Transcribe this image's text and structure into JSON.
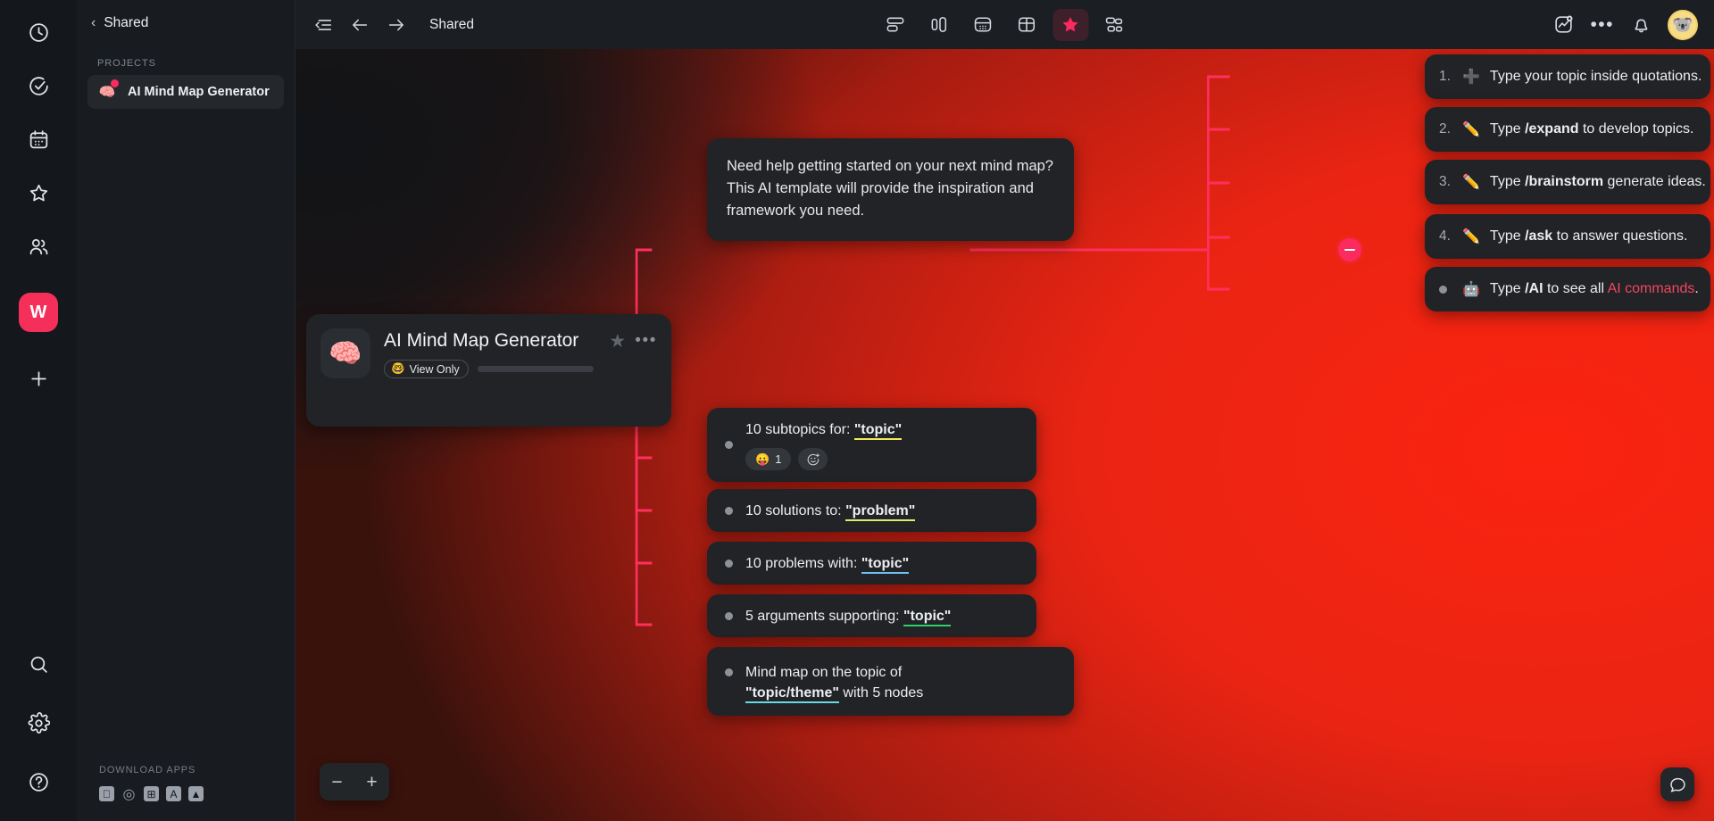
{
  "rail": {
    "items": [
      {
        "name": "recent-icon",
        "label": "Recent"
      },
      {
        "name": "tasks-icon",
        "label": "Tasks"
      },
      {
        "name": "calendar-icon",
        "label": "Calendar"
      },
      {
        "name": "favorites-icon",
        "label": "Favorites"
      },
      {
        "name": "people-icon",
        "label": "People"
      }
    ],
    "workspace_initial": "W",
    "add_label": "+",
    "bottom": [
      {
        "name": "search-icon",
        "label": "Search"
      },
      {
        "name": "settings-icon",
        "label": "Settings"
      },
      {
        "name": "help-icon",
        "label": "Help"
      }
    ],
    "accent": "#f42f5a"
  },
  "sidebar": {
    "back_chevron": "‹",
    "title": "Shared",
    "section_label": "PROJECTS",
    "project": {
      "emoji": "🧠",
      "label": "AI Mind Map Generator"
    },
    "footer": {
      "title": "DOWNLOAD APPS",
      "apps": [
        {
          "name": "apple-icon",
          "glyph": ""
        },
        {
          "name": "chrome-icon",
          "glyph": "◎"
        },
        {
          "name": "windows-icon",
          "glyph": "⊞"
        },
        {
          "name": "app-store-icon",
          "glyph": "A"
        },
        {
          "name": "android-icon",
          "glyph": "▲"
        }
      ]
    }
  },
  "topbar": {
    "breadcrumb": "Shared",
    "views": [
      {
        "name": "list-view",
        "label": "List",
        "active": false
      },
      {
        "name": "board-view",
        "label": "Board",
        "active": false
      },
      {
        "name": "calendar-view",
        "label": "Calendar",
        "active": false
      },
      {
        "name": "table-view",
        "label": "Table",
        "active": false
      },
      {
        "name": "favorite-view",
        "label": "Favorite",
        "active": true
      },
      {
        "name": "mindmap-view",
        "label": "Mind Map",
        "active": false
      }
    ],
    "more_label": "•••",
    "avatar_emoji": "🐨"
  },
  "card": {
    "emoji": "🧠",
    "title": "AI Mind Map Generator",
    "badge": {
      "emoji": "🤓",
      "label": "View Only"
    },
    "star": "★",
    "more": "•••"
  },
  "description_node": "Need help getting started on your next mind map? This AI template will provide the inspiration and framework you need.",
  "branch_nodes": [
    {
      "prefix": "10 subtopics for: ",
      "highlight": "\"topic\"",
      "highlight_class": "hl-yellow",
      "suffix": "",
      "reaction": {
        "emoji": "😛",
        "count": "1"
      }
    },
    {
      "prefix": "10 solutions to: ",
      "highlight": "\"problem\"",
      "highlight_class": "hl-lime",
      "suffix": ""
    },
    {
      "prefix": "10 problems with: ",
      "highlight": "\"topic\"",
      "highlight_class": "hl-blue",
      "suffix": ""
    },
    {
      "prefix": "5 arguments supporting: ",
      "highlight": "\"topic\"",
      "highlight_class": "hl-green",
      "suffix": ""
    },
    {
      "prefix": "Mind map on the topic of ",
      "highlight": "\"topic/theme\"",
      "highlight_class": "hl-cyan",
      "suffix": " with 5 nodes",
      "wrap": true
    }
  ],
  "instruction_nodes": [
    {
      "num": "1.",
      "emoji": "➕",
      "pre": "Type your topic inside quotations.",
      "cmd": "",
      "post": ""
    },
    {
      "num": "2.",
      "emoji": "✏️",
      "pre": "Type ",
      "cmd": "/expand",
      "post": " to develop topics."
    },
    {
      "num": "3.",
      "emoji": "✏️",
      "pre": "Type ",
      "cmd": "/brainstorm",
      "post": " generate ideas."
    },
    {
      "num": "4.",
      "emoji": "✏️",
      "pre": "Type ",
      "cmd": "/ask",
      "post": " to answer questions."
    },
    {
      "num": "",
      "emoji": "🤖",
      "pre": "Type ",
      "cmd": "/AI",
      "post": " to see all ",
      "tail": "AI commands",
      "tail_color": "#f0475f",
      "end": "."
    }
  ],
  "zoom_controls": {
    "out": "−",
    "in": "+"
  },
  "colors": {
    "accent_pink": "#fb2a5f",
    "canvas_red": "#ea2413",
    "node_bg": "#212326"
  }
}
